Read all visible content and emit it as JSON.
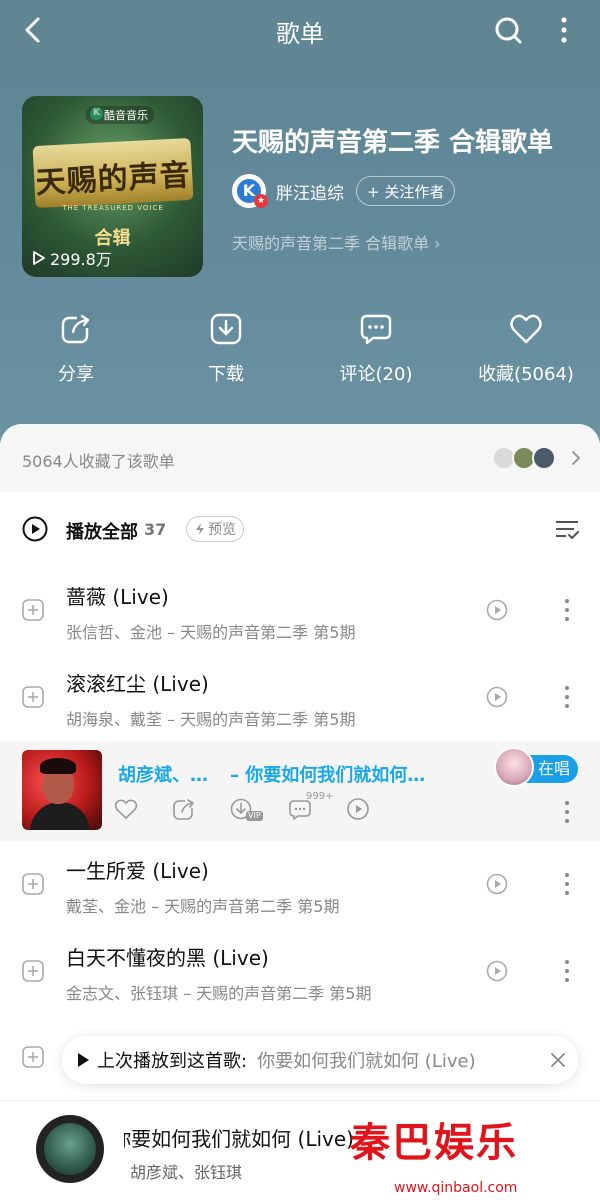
{
  "topbar": {
    "title": "歌单"
  },
  "playlist": {
    "cover_brand": "酷音音乐",
    "cover_logo": "天赐的声音",
    "cover_logo_sub": "THE TREASURED VOICE",
    "cover_tag": "合辑",
    "play_count": "299.8万",
    "title": "天赐的声音第二季 合辑歌单",
    "author": "胖汪追综",
    "follow_label": "+ 关注作者",
    "description": "天赐的声音第二季 合辑歌单 ›"
  },
  "actions": [
    {
      "label": "分享",
      "icon": "share-icon"
    },
    {
      "label": "下载",
      "icon": "download-icon"
    },
    {
      "label": "评论(20)",
      "icon": "comment-icon"
    },
    {
      "label": "收藏(5064)",
      "icon": "heart-icon"
    }
  ],
  "collect": {
    "text": "5064人收藏了该歌单"
  },
  "play_all": {
    "label": "播放全部",
    "count": "37",
    "preview_label": "预览"
  },
  "songs": [
    {
      "title": "蔷薇 (Live)",
      "sub": "张信哲、金池 – 天赐的声音第二季 第5期"
    },
    {
      "title": "滚滚红尘 (Live)",
      "sub": "胡海泉、戴荃 – 天赐的声音第二季 第5期"
    },
    {
      "title": "一生所爱 (Live)",
      "sub": "戴荃、金池 – 天赐的声音第二季 第5期"
    },
    {
      "title": "白天不懂夜的黑 (Live)",
      "sub": "金志文、张钰琪 – 天赐的声音第二季 第5期"
    }
  ],
  "now_playing_row": {
    "artists": "胡彦斌、…",
    "separator": "–",
    "title": "你要如何我们就如何…",
    "sing_label": "在唱",
    "comment_count": "999+",
    "vip_label": "VIP"
  },
  "resume_tip": {
    "label": "上次播放到这首歌:",
    "song": "你要如何我们就如何 (Live)"
  },
  "player": {
    "title": "你要如何我们就如何 (Live)",
    "artists": "胡彦斌、张钰琪"
  },
  "watermark": {
    "text": "秦巴娱乐",
    "url": "www.qinbaol.com"
  },
  "colors": {
    "header_bg": "#62899a",
    "accent_blue": "#1aa8e8",
    "watermark_red": "#e0141a"
  }
}
